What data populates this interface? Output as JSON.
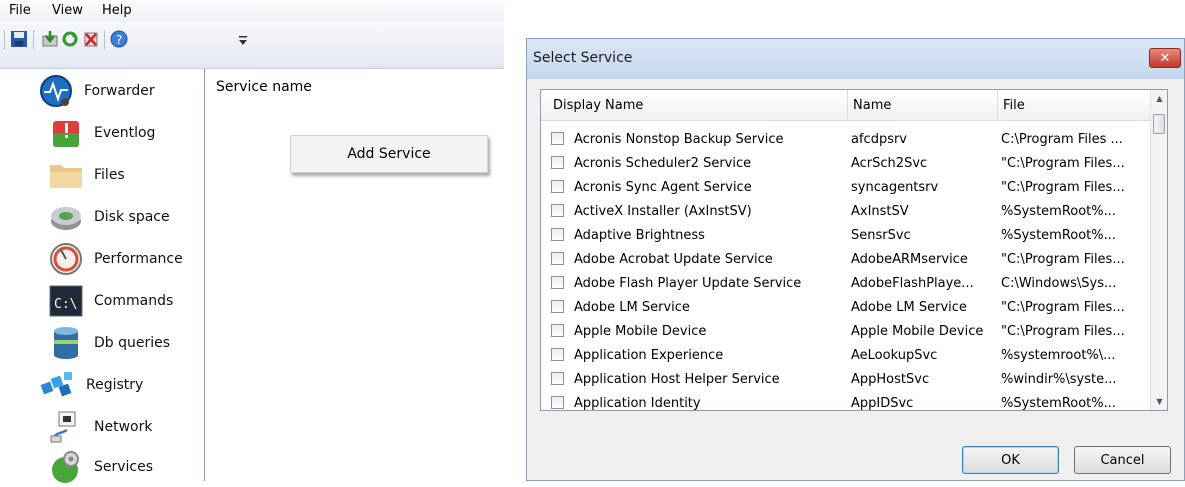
{
  "menu": [
    "File",
    "View",
    "Help"
  ],
  "toolbar": {
    "buttons": [
      "save-icon",
      "install-icon",
      "refresh-icon",
      "delete-icon",
      "help-icon"
    ],
    "overflow": "chevron-down-icon"
  },
  "sidebar": {
    "items": [
      {
        "label": "Forwarder",
        "icon": "forwarder-icon"
      },
      {
        "label": "Eventlog",
        "icon": "eventlog-icon"
      },
      {
        "label": "Files",
        "icon": "folder-icon"
      },
      {
        "label": "Disk space",
        "icon": "disk-icon"
      },
      {
        "label": "Performance",
        "icon": "gauge-icon"
      },
      {
        "label": "Commands",
        "icon": "console-icon"
      },
      {
        "label": "Db queries",
        "icon": "database-icon"
      },
      {
        "label": "Registry",
        "icon": "registry-icon"
      },
      {
        "label": "Network",
        "icon": "network-icon"
      },
      {
        "label": "Services",
        "icon": "services-icon"
      }
    ]
  },
  "content": {
    "column_header": "Service name",
    "context_menu_item": "Add Service"
  },
  "dialog": {
    "title": "Select Service",
    "close_glyph": "✕",
    "columns": [
      "Display Name",
      "Name",
      "File"
    ],
    "rows": [
      {
        "display": "Acronis Nonstop Backup Service",
        "name": "afcdpsrv",
        "file": "C:\\Program Files ..."
      },
      {
        "display": "Acronis Scheduler2 Service",
        "name": "AcrSch2Svc",
        "file": "\"C:\\Program Files..."
      },
      {
        "display": "Acronis Sync Agent Service",
        "name": "syncagentsrv",
        "file": "\"C:\\Program Files..."
      },
      {
        "display": "ActiveX Installer (AxInstSV)",
        "name": "AxInstSV",
        "file": "%SystemRoot%..."
      },
      {
        "display": "Adaptive Brightness",
        "name": "SensrSvc",
        "file": "%SystemRoot%..."
      },
      {
        "display": "Adobe Acrobat Update Service",
        "name": "AdobeARMservice",
        "file": "\"C:\\Program Files..."
      },
      {
        "display": "Adobe Flash Player Update Service",
        "name": "AdobeFlashPlaye...",
        "file": "C:\\Windows\\Sys..."
      },
      {
        "display": "Adobe LM Service",
        "name": "Adobe LM Service",
        "file": "\"C:\\Program Files..."
      },
      {
        "display": "Apple Mobile Device",
        "name": "Apple Mobile Device",
        "file": "\"C:\\Program Files..."
      },
      {
        "display": "Application Experience",
        "name": "AeLookupSvc",
        "file": "%systemroot%\\..."
      },
      {
        "display": "Application Host Helper Service",
        "name": "AppHostSvc",
        "file": "%windir%\\syste..."
      },
      {
        "display": "Application Identity",
        "name": "AppIDSvc",
        "file": "%SystemRoot%..."
      }
    ],
    "ok_label": "OK",
    "cancel_label": "Cancel"
  }
}
